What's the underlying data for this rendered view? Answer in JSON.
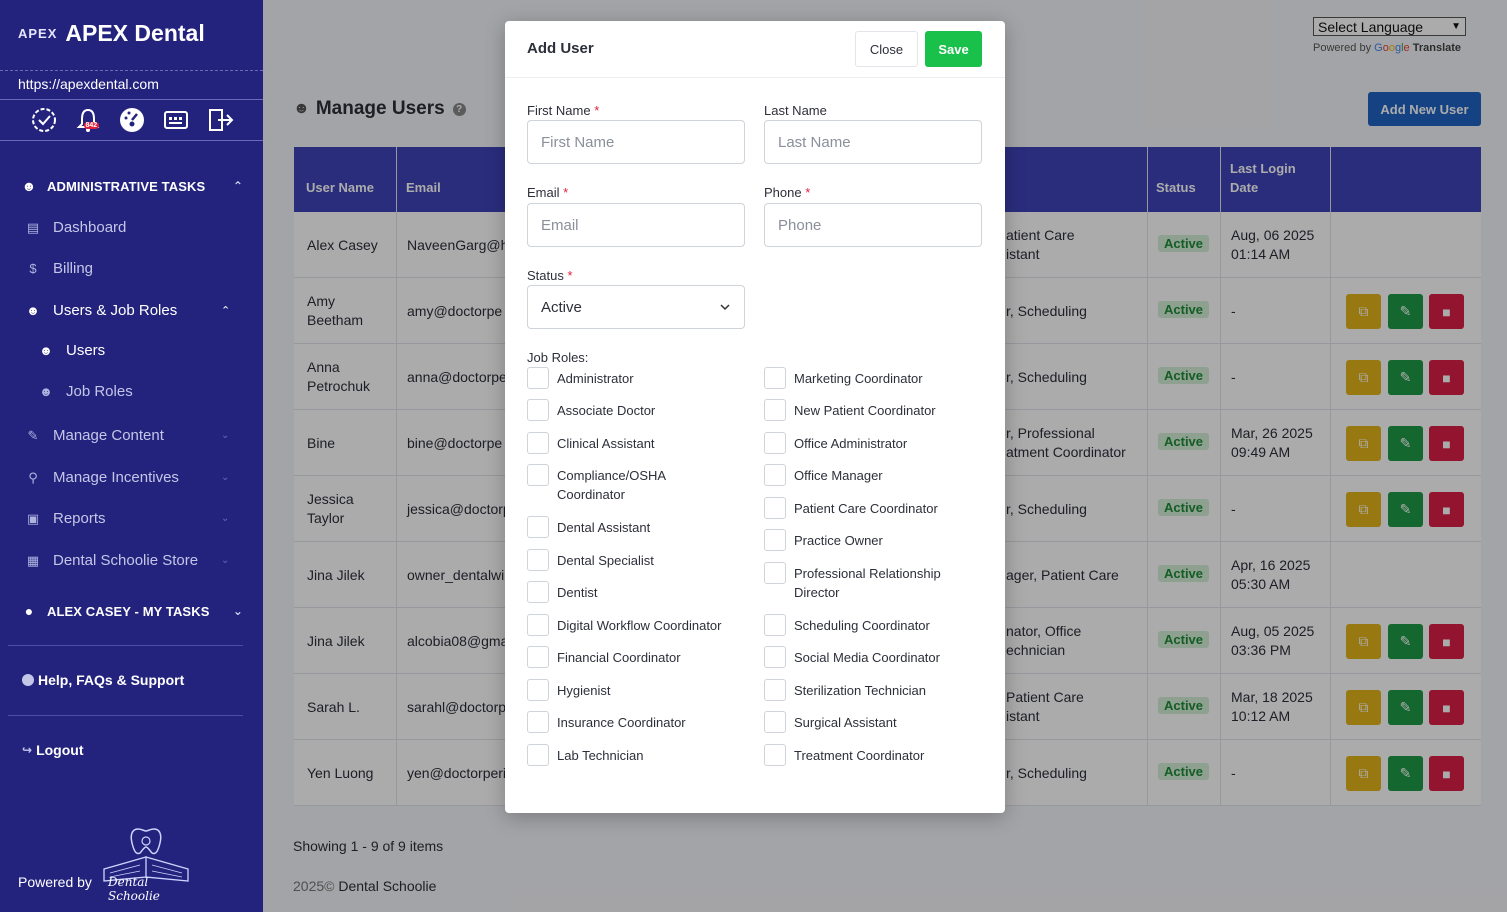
{
  "sidebar": {
    "logo_mark": "APEX",
    "brand_name": "APEX Dental",
    "url": "https://apexdental.com",
    "notification_count": "842",
    "sections": {
      "admin": "ADMINISTRATIVE TASKS",
      "my_tasks": "ALEX CASEY - MY TASKS"
    },
    "items": {
      "dashboard": "Dashboard",
      "billing": "Billing",
      "users_job_roles": "Users & Job Roles",
      "users": "Users",
      "job_roles": "Job Roles",
      "manage_content": "Manage Content",
      "manage_incentives": "Manage Incentives",
      "reports": "Reports",
      "store": "Dental Schoolie Store",
      "help": "Help, FAQs & Support",
      "logout": "Logout"
    },
    "powered_by": "Powered by",
    "school_name": "Dental Schoolie"
  },
  "translate": {
    "select_label": "Select Language",
    "powered_by": "Powered by",
    "google": [
      "G",
      "o",
      "o",
      "g",
      "l",
      "e"
    ],
    "translate": "Translate"
  },
  "page": {
    "title": "Manage Users",
    "add_button": "Add New User",
    "showing": "Showing 1 - 9 of 9 items",
    "footer_year": "2025©",
    "footer_name": "Dental Schoolie"
  },
  "table": {
    "headers": {
      "username": "User Name",
      "email": "Email",
      "status": "Status",
      "last_login_1": "Last Login",
      "last_login_2": "Date"
    },
    "rows": [
      {
        "name1": "Alex Casey",
        "name2": "",
        "email": "NaveenGarg@h",
        "role1": "atient Care",
        "role2": "istant",
        "status": "Active",
        "login1": "Aug, 06 2025",
        "login2": "01:14 AM",
        "actions": false
      },
      {
        "name1": "Amy",
        "name2": "Beetham",
        "email": "amy@doctorpe",
        "role1": "r, Scheduling",
        "role2": "",
        "status": "Active",
        "login1": "-",
        "login2": "",
        "actions": true
      },
      {
        "name1": "Anna",
        "name2": "Petrochuk",
        "email": "anna@doctorpe",
        "role1": "r, Scheduling",
        "role2": "",
        "status": "Active",
        "login1": "-",
        "login2": "",
        "actions": true
      },
      {
        "name1": "Bine",
        "name2": "",
        "email": "bine@doctorpe",
        "role1": "r, Professional",
        "role2": "atment Coordinator",
        "status": "Active",
        "login1": "Mar, 26 2025",
        "login2": "09:49 AM",
        "actions": true
      },
      {
        "name1": "Jessica",
        "name2": "Taylor",
        "email": "jessica@doctorp",
        "role1": "r, Scheduling",
        "role2": "",
        "status": "Active",
        "login1": "-",
        "login2": "",
        "actions": true
      },
      {
        "name1": "Jina Jilek",
        "name2": "",
        "email": "owner_dentalwi",
        "role1": "ager, Patient Care",
        "role2": "",
        "status": "Active",
        "login1": "Apr, 16 2025",
        "login2": "05:30 AM",
        "actions": false
      },
      {
        "name1": "Jina Jilek",
        "name2": "",
        "email": "alcobia08@gma",
        "role1": "nator, Office",
        "role2": "echnician",
        "status": "Active",
        "login1": "Aug, 05 2025",
        "login2": "03:36 PM",
        "actions": true
      },
      {
        "name1": "Sarah L.",
        "name2": "",
        "email": "sarahl@doctorp",
        "role1": "Patient Care",
        "role2": "istant",
        "status": "Active",
        "login1": "Mar, 18 2025",
        "login2": "10:12 AM",
        "actions": true
      },
      {
        "name1": "Yen Luong",
        "name2": "",
        "email": "yen@doctorperi",
        "role1": "r, Scheduling",
        "role2": "",
        "status": "Active",
        "login1": "-",
        "login2": "",
        "actions": true
      }
    ]
  },
  "modal": {
    "title": "Add User",
    "close": "Close",
    "save": "Save",
    "required_mark": "*",
    "first_name_label": "First Name",
    "first_name_placeholder": "First Name",
    "last_name_label": "Last Name",
    "last_name_placeholder": "Last Name",
    "email_label": "Email",
    "email_placeholder": "Email",
    "phone_label": "Phone",
    "phone_placeholder": "Phone",
    "status_label": "Status",
    "status_value": "Active",
    "job_roles_label": "Job Roles:",
    "roles_left": [
      "Administrator",
      "Associate Doctor",
      "Clinical Assistant",
      "Compliance/OSHA Coordinator",
      "Dental Assistant",
      "Dental Specialist",
      "Dentist",
      "Digital Workflow Coordinator",
      "Financial Coordinator",
      "Hygienist",
      "Insurance Coordinator",
      "Lab Technician"
    ],
    "roles_right": [
      "Marketing Coordinator",
      "New Patient Coordinator",
      "Office Administrator",
      "Office Manager",
      "Patient Care Coordinator",
      "Practice Owner",
      "Professional Relationship Director",
      "Scheduling Coordinator",
      "Social Media Coordinator",
      "Sterilization Technician",
      "Surgical Assistant",
      "Treatment Coordinator"
    ]
  }
}
